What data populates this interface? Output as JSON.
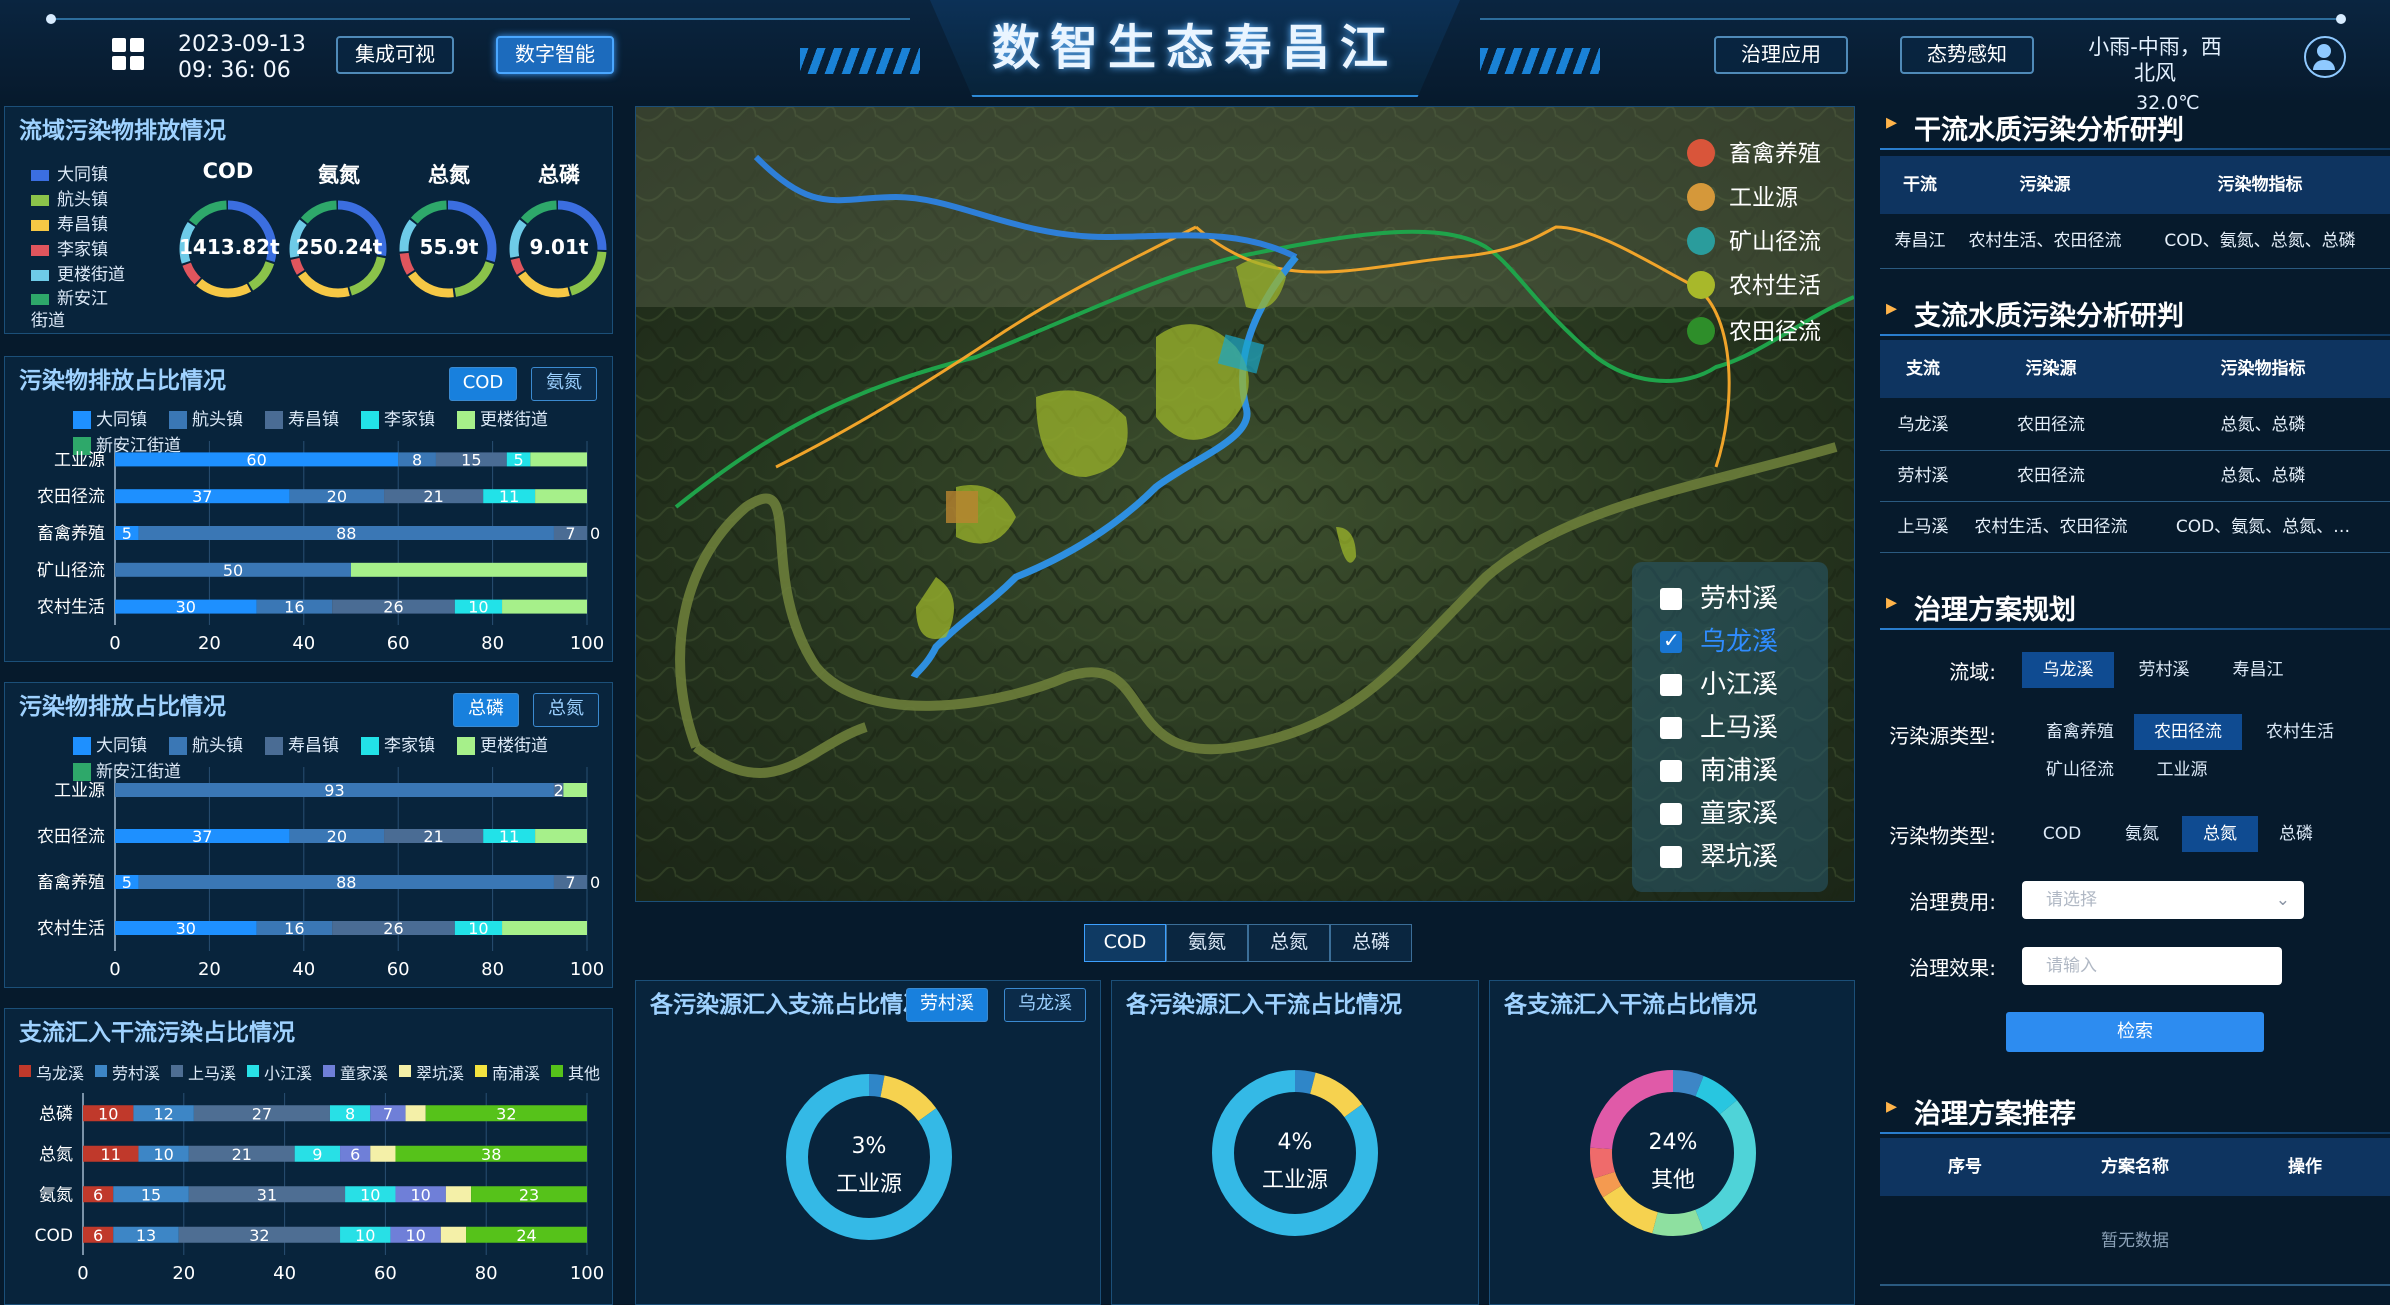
{
  "header": {
    "title": "数智生态寿昌江",
    "date": "2023-09-13",
    "time": "09: 36: 06",
    "nav_left": [
      "集成可视",
      "数字智能"
    ],
    "nav_right": [
      "治理应用",
      "态势感知"
    ],
    "weather": "小雨-中雨，西北风",
    "temperature": "32.0℃",
    "icons": {
      "menu": "grid-icon",
      "user": "user-icon"
    }
  },
  "emission_panel": {
    "title": "流域污染物排放情况",
    "legend": [
      {
        "name": "大同镇",
        "color": "#3b6ee0"
      },
      {
        "name": "航头镇",
        "color": "#8bc34a"
      },
      {
        "name": "寿昌镇",
        "color": "#f6c845"
      },
      {
        "name": "李家镇",
        "color": "#e0555d"
      },
      {
        "name": "更楼街道",
        "color": "#6ecbe8"
      },
      {
        "name": "新安江街道",
        "color": "#2ea86a"
      }
    ],
    "donuts": [
      {
        "label": "COD",
        "value": "1413.82t"
      },
      {
        "label": "氨氮",
        "value": "250.24t"
      },
      {
        "label": "总氮",
        "value": "55.9t"
      },
      {
        "label": "总磷",
        "value": "9.01t"
      }
    ]
  },
  "share_panel_1": {
    "title": "污染物排放占比情况",
    "buttons": [
      "COD",
      "氨氮"
    ],
    "active_button": 0
  },
  "share_panel_2": {
    "title": "污染物排放占比情况",
    "buttons": [
      "总磷",
      "总氮"
    ],
    "active_button": 0
  },
  "tributary_panel": {
    "title": "支流汇入干流污染占比情况"
  },
  "chart_data": [
    {
      "type": "bar",
      "stacked": true,
      "orientation": "horizontal",
      "categories": [
        "工业源",
        "农田径流",
        "畜禽养殖",
        "矿山径流",
        "农村生活"
      ],
      "series": [
        {
          "name": "大同镇",
          "color": "#1e90ff",
          "values": [
            60,
            37,
            5,
            0,
            30
          ]
        },
        {
          "name": "航头镇",
          "color": "#3a77b5",
          "values": [
            8,
            20,
            88,
            50,
            16
          ]
        },
        {
          "name": "寿昌镇",
          "color": "#4a6c94",
          "values": [
            15,
            21,
            7,
            0,
            26
          ]
        },
        {
          "name": "李家镇",
          "color": "#22e2e8",
          "values": [
            5,
            11,
            0,
            0,
            10
          ]
        },
        {
          "name": "更楼街道",
          "color": "#a6f08a",
          "values": [
            12,
            11,
            0,
            50,
            18
          ]
        }
      ],
      "extra_legend": "新安江街道",
      "value_labels": [
        [
          "60",
          "8",
          "15",
          "5",
          ""
        ],
        [
          "37",
          "20",
          "21",
          "11",
          ""
        ],
        [
          "5",
          "88",
          "7",
          "0",
          ""
        ],
        [
          "0",
          "50",
          "",
          "",
          ""
        ],
        [
          "30",
          "16",
          "26",
          "10",
          ""
        ]
      ],
      "xlim": [
        0,
        100
      ],
      "xticks": [
        "0",
        "20",
        "40",
        "60",
        "80",
        "100"
      ]
    },
    {
      "type": "bar",
      "stacked": true,
      "orientation": "horizontal",
      "categories": [
        "工业源",
        "农田径流",
        "畜禽养殖",
        "农村生活"
      ],
      "series": [
        {
          "name": "大同镇",
          "color": "#1e90ff",
          "values": [
            0,
            37,
            5,
            30
          ]
        },
        {
          "name": "航头镇",
          "color": "#3a77b5",
          "values": [
            93,
            20,
            88,
            16
          ]
        },
        {
          "name": "寿昌镇",
          "color": "#4a6c94",
          "values": [
            2,
            21,
            7,
            26
          ]
        },
        {
          "name": "李家镇",
          "color": "#22e2e8",
          "values": [
            0,
            11,
            0,
            10
          ]
        },
        {
          "name": "更楼街道",
          "color": "#a6f08a",
          "values": [
            5,
            11,
            0,
            18
          ]
        }
      ],
      "extra_legend": "新安江街道",
      "value_labels": [
        [
          "",
          "93",
          "2",
          "",
          ""
        ],
        [
          "37",
          "20",
          "21",
          "11",
          ""
        ],
        [
          "5",
          "88",
          "7",
          "0",
          ""
        ],
        [
          "30",
          "16",
          "26",
          "10",
          ""
        ]
      ],
      "xlim": [
        0,
        100
      ],
      "xticks": [
        "0",
        "20",
        "40",
        "60",
        "80",
        "100"
      ]
    },
    {
      "type": "bar",
      "stacked": true,
      "orientation": "horizontal",
      "categories": [
        "总磷",
        "总氮",
        "氨氮",
        "COD"
      ],
      "series": [
        {
          "name": "乌龙溪",
          "color": "#c0392b",
          "values": [
            10,
            11,
            6,
            6
          ]
        },
        {
          "name": "劳村溪",
          "color": "#3d86c6",
          "values": [
            12,
            10,
            15,
            13
          ]
        },
        {
          "name": "上马溪",
          "color": "#4e6e93",
          "values": [
            27,
            21,
            31,
            32
          ]
        },
        {
          "name": "小江溪",
          "color": "#28e0e6",
          "values": [
            8,
            9,
            10,
            10
          ]
        },
        {
          "name": "童家溪",
          "color": "#6f7fd8",
          "values": [
            7,
            6,
            10,
            10
          ]
        },
        {
          "name": "翠坑溪",
          "color": "#f4f0a8",
          "values": [
            4,
            5,
            5,
            5
          ]
        },
        {
          "name": "南浦溪",
          "color": "#f3e340",
          "values": [
            0,
            0,
            0,
            0
          ]
        },
        {
          "name": "其他",
          "color": "#56c21a",
          "values": [
            32,
            38,
            23,
            24
          ]
        }
      ],
      "value_labels": [
        [
          "10",
          "12",
          "27",
          "8",
          "7",
          "",
          "",
          "32"
        ],
        [
          "11",
          "10",
          "21",
          "9",
          "6",
          "",
          "",
          "38"
        ],
        [
          "6",
          "15",
          "31",
          "10",
          "10",
          "",
          "",
          "23"
        ],
        [
          "6",
          "13",
          "32",
          "10",
          "10",
          "",
          "",
          "24"
        ]
      ],
      "xlim": [
        0,
        100
      ],
      "xticks": [
        "0",
        "20",
        "40",
        "60",
        "80",
        "100"
      ]
    },
    {
      "type": "pie",
      "title": "各污染源汇入支流占比情况",
      "center_value": "3%",
      "center_label": "工业源",
      "slices": [
        {
          "value": 3,
          "color": "#2f86c8"
        },
        {
          "value": 12,
          "color": "#f6d24f"
        },
        {
          "value": 85,
          "color": "#34b9e6"
        }
      ]
    },
    {
      "type": "pie",
      "title": "各污染源汇入干流占比情况",
      "center_value": "4%",
      "center_label": "工业源",
      "slices": [
        {
          "value": 4,
          "color": "#2f86c8"
        },
        {
          "value": 11,
          "color": "#f6d24f"
        },
        {
          "value": 85,
          "color": "#34b9e6"
        }
      ]
    },
    {
      "type": "pie",
      "title": "各支流汇入干流占比情况",
      "center_value": "24%",
      "center_label": "其他",
      "slices": [
        {
          "value": 6,
          "color": "#3d86c6"
        },
        {
          "value": 8,
          "color": "#28c6e0"
        },
        {
          "value": 30,
          "color": "#4fd3d8"
        },
        {
          "value": 10,
          "color": "#8ee0a0"
        },
        {
          "value": 12,
          "color": "#f6d24f"
        },
        {
          "value": 4,
          "color": "#f49a50"
        },
        {
          "value": 6,
          "color": "#ef6b6b"
        },
        {
          "value": 24,
          "color": "#e05aa8"
        }
      ]
    }
  ],
  "donut_panels": {
    "p1_buttons": [
      "劳村溪",
      "乌龙溪"
    ],
    "p1_active": 0
  },
  "map": {
    "source_legend": [
      {
        "name": "畜禽养殖",
        "color": "#d9553a"
      },
      {
        "name": "工业源",
        "color": "#d5983a"
      },
      {
        "name": "矿山径流",
        "color": "#2a9c9c"
      },
      {
        "name": "农村生活",
        "color": "#a8b82a"
      },
      {
        "name": "农田径流",
        "color": "#2e8e2a"
      }
    ],
    "streams": [
      {
        "name": "劳村溪",
        "checked": false
      },
      {
        "name": "乌龙溪",
        "checked": true
      },
      {
        "name": "小江溪",
        "checked": false
      },
      {
        "name": "上马溪",
        "checked": false
      },
      {
        "name": "南浦溪",
        "checked": false
      },
      {
        "name": "童家溪",
        "checked": false
      },
      {
        "name": "翠坑溪",
        "checked": false
      }
    ],
    "tabs": [
      "COD",
      "氨氮",
      "总氮",
      "总磷"
    ],
    "active_tab": 0
  },
  "right": {
    "main_title": "干流水质污染分析研判",
    "main_headers": [
      "干流",
      "污染源",
      "污染物指标"
    ],
    "main_rows": [
      [
        "寿昌江",
        "农村生活、农田径流",
        "COD、氨氮、总氮、总磷"
      ]
    ],
    "branch_title": "支流水质污染分析研判",
    "branch_headers": [
      "支流",
      "污染源",
      "污染物指标"
    ],
    "branch_rows": [
      [
        "乌龙溪",
        "农田径流",
        "总氮、总磷"
      ],
      [
        "劳村溪",
        "农田径流",
        "总氮、总磷"
      ],
      [
        "上马溪",
        "农村生活、农田径流",
        "COD、氨氮、总氮、…"
      ]
    ],
    "plan_title": "治理方案规划",
    "basin_label": "流域:",
    "basin_options": [
      "乌龙溪",
      "劳村溪",
      "寿昌江"
    ],
    "source_label": "污染源类型:",
    "source_options": [
      "畜禽养殖",
      "农田径流",
      "农村生活",
      "矿山径流",
      "工业源"
    ],
    "pollutant_label": "污染物类型:",
    "pollutant_options": [
      "COD",
      "氨氮",
      "总氮",
      "总磷"
    ],
    "cost_label": "治理费用:",
    "cost_placeholder": "请选择",
    "effect_label": "治理效果:",
    "effect_placeholder": "请输入",
    "search_button": "检索",
    "recommend_title": "治理方案推荐",
    "recommend_headers": [
      "序号",
      "方案名称",
      "操作"
    ],
    "empty_text": "暂无数据"
  }
}
